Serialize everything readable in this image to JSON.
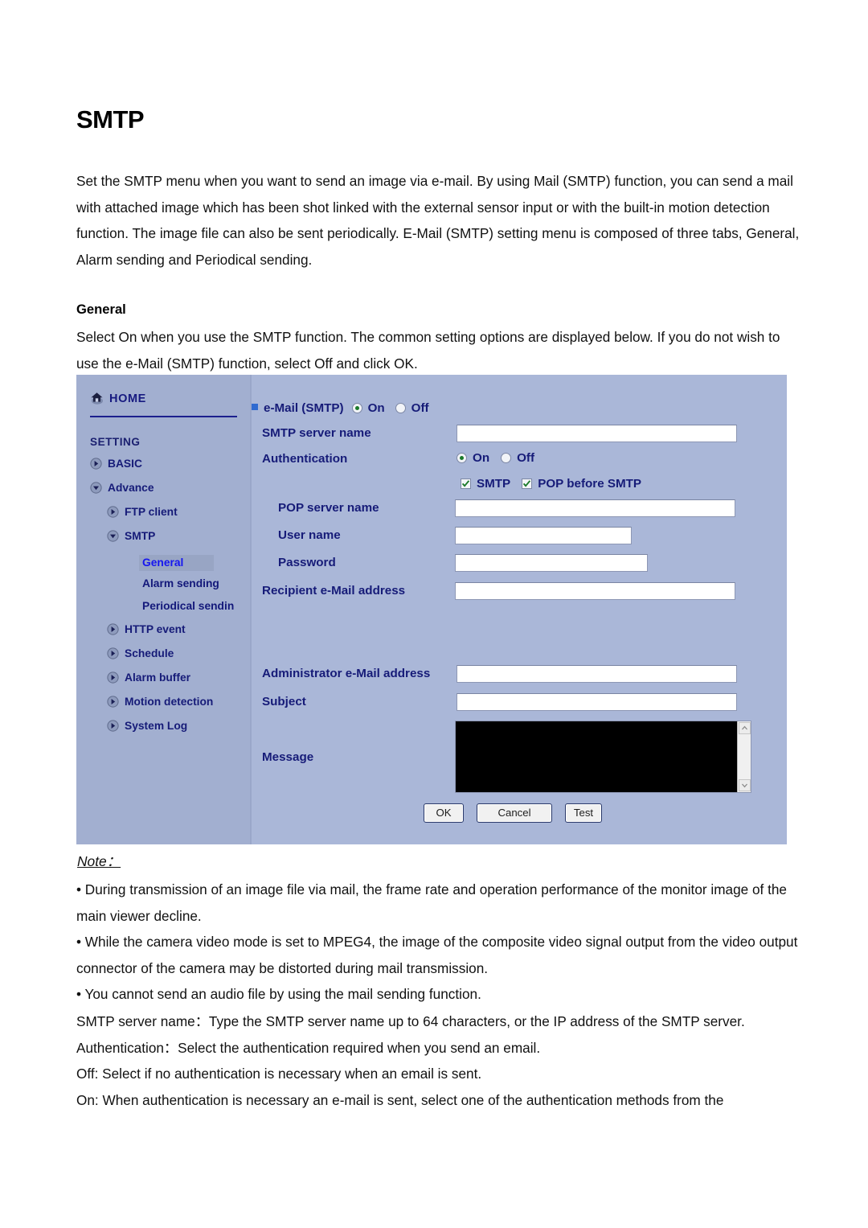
{
  "document": {
    "title": "SMTP",
    "intro": "Set the SMTP menu when you want to send an image via e-mail. By using Mail (SMTP) function, you can send a mail with attached image which has been shot linked with the external sensor input or with the built-in motion detection function. The image file can also be sent periodically. E-Mail (SMTP) setting menu is composed of three tabs, General, Alarm sending and Periodical sending.",
    "section_heading": "General",
    "section_body": "Select On when you use the SMTP function. The common setting options are displayed below. If you do not wish to use the e-Mail (SMTP) function, select Off and click OK.",
    "note_label": "Note：",
    "notes": [
      "• During transmission of an image file via mail, the frame rate and operation performance of the monitor image of the main viewer decline.",
      "• While the camera video mode is set to MPEG4, the image of the composite video signal output from the video output connector of the camera may be distorted during mail transmission.",
      "• You cannot send an audio file by using the mail sending function."
    ],
    "tail": [
      "SMTP server name：Type the SMTP server name up to 64 characters, or the IP address of the SMTP server.",
      "Authentication：Select the authentication required when you send an email.",
      "Off: Select if no authentication is necessary when an email is sent.",
      "On: When authentication is necessary an e-mail is sent, select one of the authentication methods from the"
    ]
  },
  "screenshot": {
    "sidebar": {
      "home_label": "HOME",
      "setting_label": "SETTING",
      "items": [
        {
          "label": "BASIC",
          "arrow": "right"
        },
        {
          "label": "Advance",
          "arrow": "down"
        },
        {
          "label": "FTP client",
          "arrow": "right"
        },
        {
          "label": "SMTP",
          "arrow": "down"
        },
        {
          "label": "HTTP event",
          "arrow": "right"
        },
        {
          "label": "Schedule",
          "arrow": "right"
        },
        {
          "label": "Alarm buffer",
          "arrow": "right"
        },
        {
          "label": "Motion detection",
          "arrow": "right"
        },
        {
          "label": "System Log",
          "arrow": "right"
        }
      ],
      "sub_items": [
        {
          "label": "General",
          "selected": true
        },
        {
          "label": "Alarm sending",
          "selected": false
        },
        {
          "label": "Periodical sendin",
          "selected": false
        }
      ]
    },
    "form": {
      "email_smtp_label": "e-Mail (SMTP)",
      "email_smtp_on": "On",
      "email_smtp_off": "Off",
      "email_smtp_value": "On",
      "smtp_server_name_label": "SMTP server name",
      "smtp_server_name_value": "",
      "authentication_label": "Authentication",
      "authentication_on": "On",
      "authentication_off": "Off",
      "authentication_value": "On",
      "check_smtp_label": "SMTP",
      "check_smtp_value": "checked",
      "check_pop_label": "POP before SMTP",
      "check_pop_value": "checked",
      "pop_server_name_label": "POP server name",
      "pop_server_name_value": "",
      "user_name_label": "User name",
      "user_name_value": "",
      "password_label": "Password",
      "password_value": "",
      "recipient_label": "Recipient e-Mail address",
      "recipient_value": "",
      "administrator_label": "Administrator e-Mail address",
      "administrator_value": "",
      "subject_label": "Subject",
      "subject_value": "",
      "message_label": "Message",
      "message_value": "",
      "ok_label": "OK",
      "cancel_label": "Cancel",
      "test_label": "Test"
    },
    "colors": {
      "panel_bg": "#aab7d8",
      "sidebar_bg": "#a2afd0",
      "nav_text": "#161b78",
      "selected_text": "#1616f0",
      "selected_bg": "#98a5c4",
      "field_bg": "#ffffff",
      "textarea_bg": "#000000"
    }
  }
}
